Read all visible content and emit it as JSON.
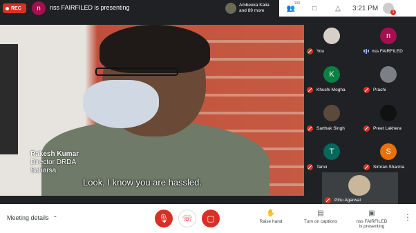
{
  "topbar": {
    "rec_label": "REC",
    "presenter_initial": "n",
    "presenting_text": "nss FAIRFILED is presenting",
    "joined_line1": "Ambeeka Kalia",
    "joined_line2": "and 89 more",
    "participants_count": "100",
    "clock": "3:21 PM",
    "notification_count": "1"
  },
  "video": {
    "speaker_name": "Rakesh Kumar",
    "speaker_role": "Director DRDA",
    "speaker_place": "Saharsa",
    "subtitle": "Look, I know you are hassled."
  },
  "tiles": [
    {
      "name": "You",
      "avatar_type": "photo",
      "muted": true
    },
    {
      "name": "nss FAIRFILED",
      "avatar_type": "initial",
      "initial": "n",
      "color": "#a50e50",
      "muted": false
    },
    {
      "name": "Khushi Mogha",
      "avatar_type": "initial",
      "initial": "K",
      "color": "#0b8043",
      "muted": true
    },
    {
      "name": "Prachi",
      "avatar_type": "photo",
      "muted": true
    },
    {
      "name": "Sarthak Singh",
      "avatar_type": "photo",
      "muted": true
    },
    {
      "name": "Preet Lakhera",
      "avatar_type": "photo",
      "muted": true
    },
    {
      "name": "Tanvi",
      "avatar_type": "initial",
      "initial": "T",
      "color": "#00695c",
      "muted": true
    },
    {
      "name": "Simran Sharma",
      "avatar_type": "initial",
      "initial": "S",
      "color": "#e8710a",
      "muted": true
    },
    {
      "name": "Pihu Agarwal",
      "avatar_type": "photo",
      "muted": true
    }
  ],
  "bottombar": {
    "meeting_details": "Meeting details",
    "raise_hand": "Raise hand",
    "captions": "Turn on captions",
    "presenting_line1": "nss FAIRFILED",
    "presenting_line2": "is presenting"
  }
}
